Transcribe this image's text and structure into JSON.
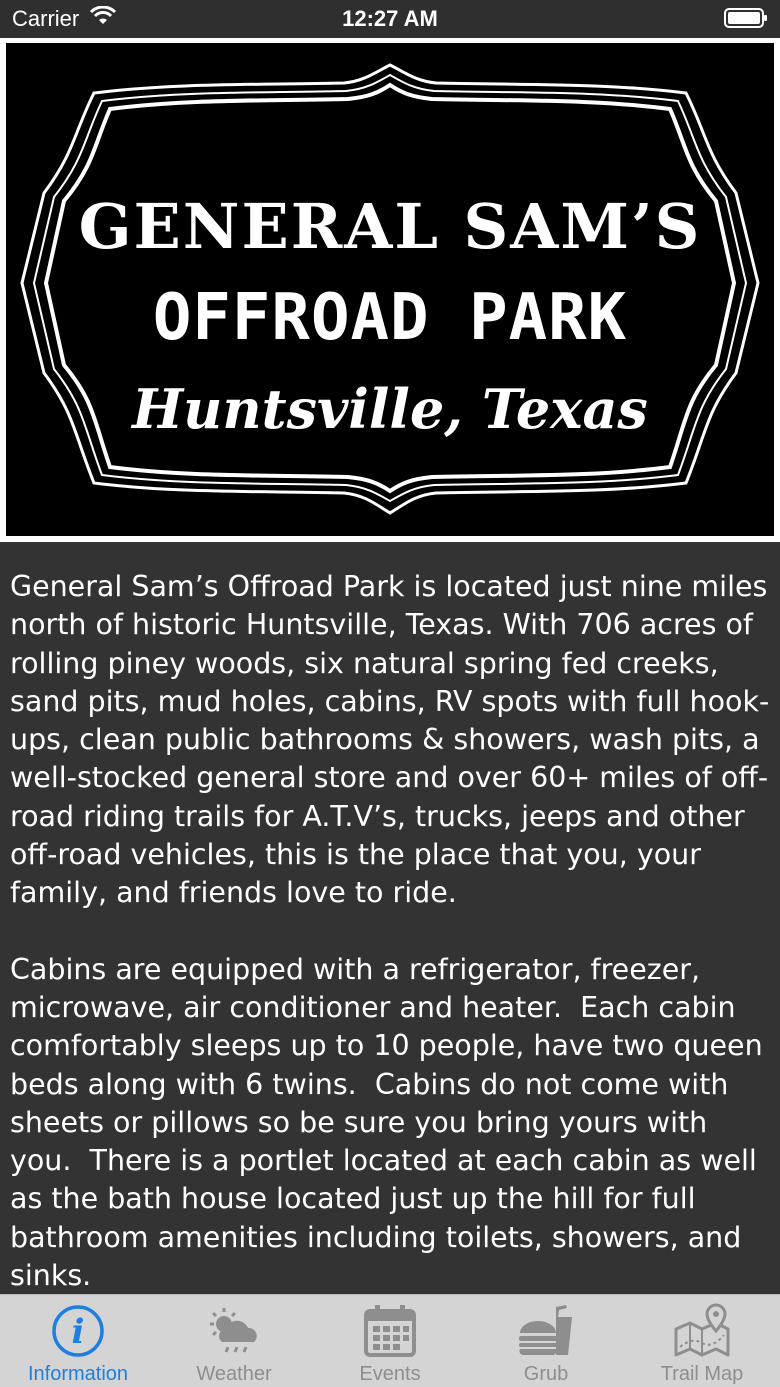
{
  "status_bar": {
    "carrier": "Carrier",
    "time": "12:27 AM"
  },
  "logo": {
    "line1": "GENERAL SAM’S",
    "line2": "OFFROAD PARK",
    "line3": "Huntsville, Texas"
  },
  "content": {
    "paragraphs": [
      "General Sam’s Offroad Park is located just nine miles north of historic Huntsville, Texas. With 706 acres of rolling piney woods, six natural spring fed creeks, sand pits, mud holes, cabins, RV spots with full hook-ups, clean public bathrooms & showers, wash pits, a well-stocked general store and over 60+ miles of off-road riding trails for A.T.V’s, trucks, jeeps and other off-road vehicles, this is the place that you, your family, and friends love to ride.",
      "Cabins are equipped with a refrigerator, freezer, microwave, air conditioner and heater.  Each cabin comfortably sleeps up to 10 people, have two queen beds along with 6 twins.  Cabins do not come with sheets or pillows so be sure you bring yours with you.  There is a portlet located at each cabin as well as the bath house located just up the hill for full bathroom amenities including toilets, showers, and sinks."
    ]
  },
  "tabbar": {
    "tabs": [
      {
        "label": "Information",
        "icon": "info-icon",
        "active": true
      },
      {
        "label": "Weather",
        "icon": "weather-icon",
        "active": false
      },
      {
        "label": "Events",
        "icon": "calendar-icon",
        "active": false
      },
      {
        "label": "Grub",
        "icon": "food-icon",
        "active": false
      },
      {
        "label": "Trail Map",
        "icon": "map-icon",
        "active": false
      }
    ]
  },
  "colors": {
    "active_tab": "#1f7fe0",
    "inactive_tab": "#8e8e8e",
    "content_bg": "#333333",
    "tabbar_bg": "#d4d4d4"
  }
}
